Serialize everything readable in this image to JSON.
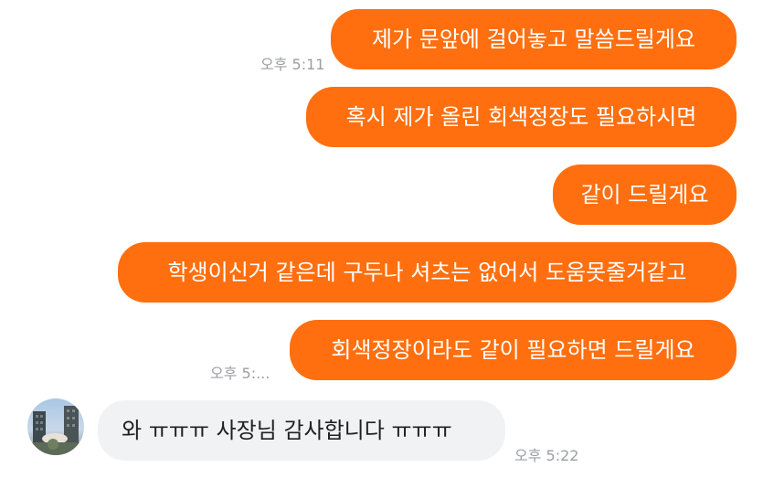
{
  "messages": [
    {
      "text": "제가 문앞에 걸어놓고 말씀드릴게요",
      "time": "오후 5:11"
    },
    {
      "text": "혹시 제가 올린 회색정장도 필요하시면"
    },
    {
      "text": "같이 드릴게요"
    },
    {
      "text": "학생이신거 같은데 구두나 셔츠는 없어서 도움못줄거같고"
    },
    {
      "text": "회색정장이라도 같이 필요하면 드릴게요",
      "time": "오후 5:..."
    }
  ],
  "reply": {
    "text": "와 ㅠㅠㅠ 사장님 감사합니다 ㅠㅠㅠ",
    "time": "오후 5:22",
    "avatar_icon": "user-avatar-photo"
  },
  "colors": {
    "outgoing_bubble": "#ff6f0f",
    "incoming_bubble": "#f1f2f4",
    "timestamp": "#9b9ea4"
  }
}
